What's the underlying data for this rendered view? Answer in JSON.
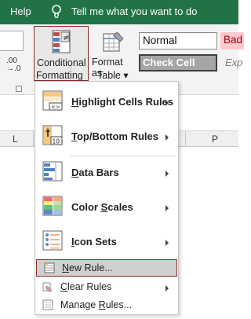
{
  "titlebar": {
    "help": "Help",
    "tell_me": "Tell me what you want to do"
  },
  "ribbon": {
    "decimal_label": ".00\n→.0",
    "cf_line1": "Conditional",
    "cf_line2": "Formatting",
    "fat_line1": "Format as",
    "fat_line2": "Table",
    "styles": {
      "normal": "Normal",
      "bad": "Bad",
      "check_cell": "Check Cell",
      "explanatory": "Exp"
    }
  },
  "columns": {
    "l": "L",
    "p": "P"
  },
  "menu": {
    "items": [
      {
        "label": "Highlight Cells Rules",
        "hotkey": "H",
        "has_submenu": true
      },
      {
        "label": "Top/Bottom Rules",
        "hotkey": "T",
        "has_submenu": true
      },
      {
        "label": "Data Bars",
        "hotkey": "D",
        "has_submenu": true
      },
      {
        "label": "Color Scales",
        "hotkey": "S",
        "has_submenu": true
      },
      {
        "label": "Icon Sets",
        "hotkey": "I",
        "has_submenu": true
      }
    ],
    "small_items": [
      {
        "label": "New Rule...",
        "hotkey": "N",
        "has_submenu": false,
        "highlighted": true
      },
      {
        "label": "Clear Rules",
        "hotkey": "C",
        "has_submenu": true
      },
      {
        "label": "Manage Rules...",
        "hotkey": "R",
        "has_submenu": false
      }
    ]
  },
  "colors": {
    "ribbon_green": "#217346",
    "highlight_border": "#8b2a2a",
    "bad_bg": "#ffc7ce",
    "check_bg": "#a5a5a5"
  }
}
